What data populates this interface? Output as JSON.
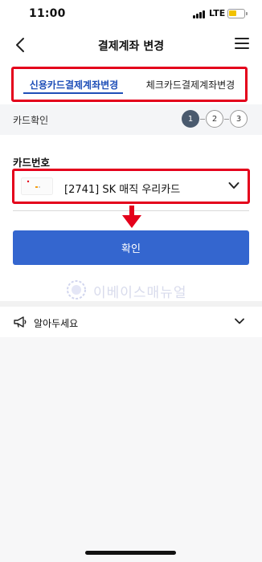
{
  "status_bar": {
    "time": "11:00",
    "network": "LTE",
    "battery_color": "#f2c200"
  },
  "header": {
    "title": "결제계좌 변경",
    "back_icon": "chevron-left-icon",
    "menu_icon": "hamburger-menu-icon"
  },
  "tabs": [
    {
      "label": "신용카드결제계좌변경",
      "active": true
    },
    {
      "label": "체크카드결제계좌변경",
      "active": false
    }
  ],
  "steps": {
    "label": "카드확인",
    "items": [
      "1",
      "2",
      "3"
    ],
    "current": 1
  },
  "card": {
    "label": "카드번호",
    "selected": "[2741] SK 매직 우리카드"
  },
  "confirm_button": {
    "label": "확인"
  },
  "watermark": {
    "text": "이베이스매뉴얼"
  },
  "notice": {
    "label": "알아두세요"
  },
  "colors": {
    "accent_blue": "#3466cf",
    "highlight_red": "#e4001b",
    "tab_active": "#1f4fb8"
  }
}
